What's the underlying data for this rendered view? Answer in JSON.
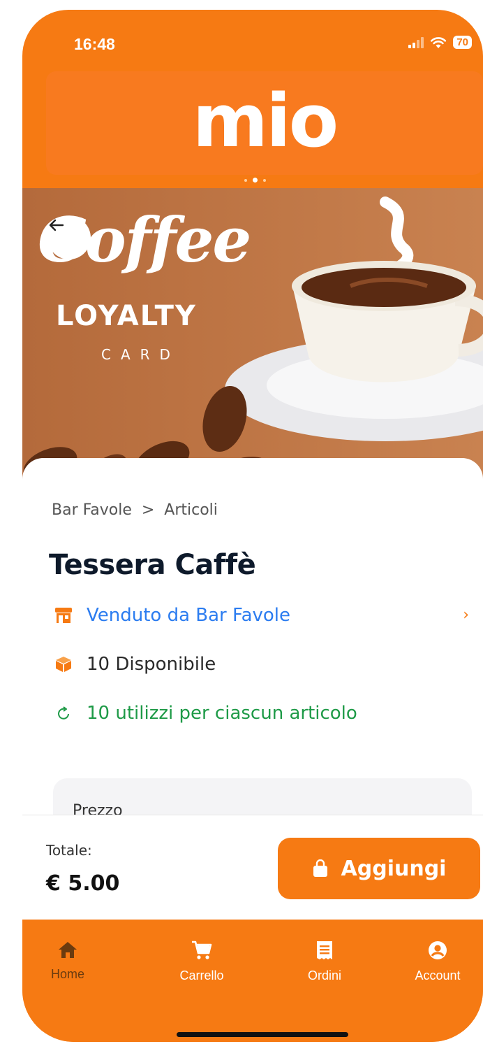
{
  "status": {
    "time": "16:48",
    "battery": "70"
  },
  "brand": {
    "logo": "mio"
  },
  "banner": {
    "line1": "Coffee",
    "line2": "LOYALTY",
    "line3": "CARD"
  },
  "breadcrumb": {
    "store": "Bar Favole",
    "section": "Articoli"
  },
  "product": {
    "title": "Tessera Caffè",
    "seller": "Venduto da Bar Favole",
    "availability": "10 Disponibile",
    "uses": "10 utilizzi per ciascun articolo",
    "price_label": "Prezzo"
  },
  "checkout": {
    "total_label": "Totale:",
    "total_value": "€ 5.00",
    "add_label": "Aggiungi"
  },
  "tabs": [
    {
      "label": "Home",
      "icon": "home-icon"
    },
    {
      "label": "Carrello",
      "icon": "cart-icon"
    },
    {
      "label": "Ordini",
      "icon": "receipt-icon"
    },
    {
      "label": "Account",
      "icon": "account-icon"
    }
  ],
  "colors": {
    "primary": "#f67a13",
    "link": "#2b7cf0",
    "success": "#1e9a47",
    "title": "#0e1a2b"
  }
}
